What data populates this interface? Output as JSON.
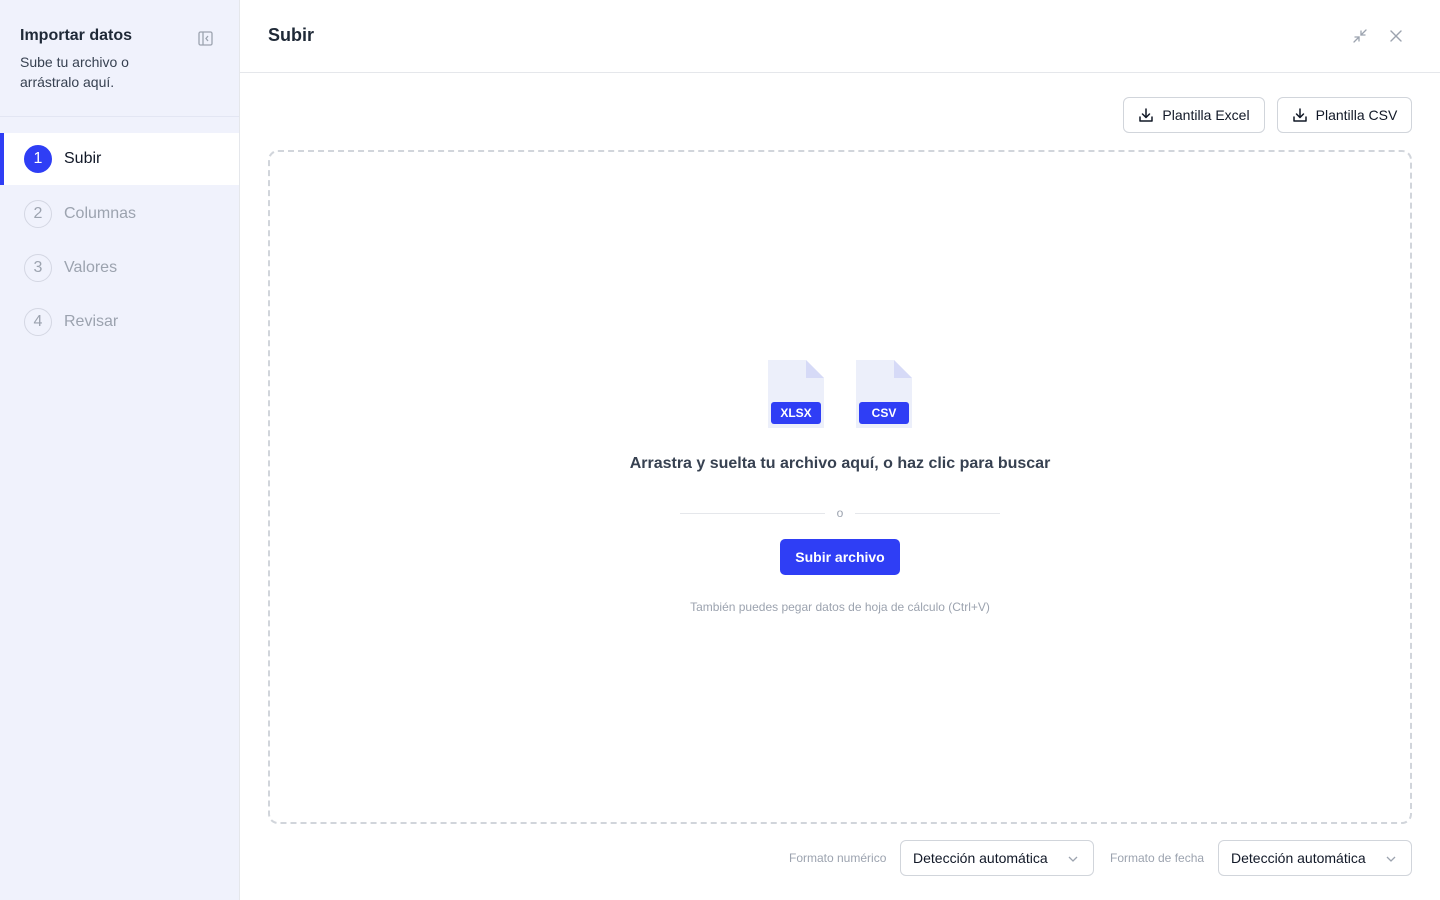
{
  "sidebar": {
    "title": "Importar datos",
    "subtitle": "Sube tu archivo o arrástralo aquí.",
    "steps": [
      {
        "number": "1",
        "label": "Subir",
        "active": true
      },
      {
        "number": "2",
        "label": "Columnas",
        "active": false
      },
      {
        "number": "3",
        "label": "Valores",
        "active": false
      },
      {
        "number": "4",
        "label": "Revisar",
        "active": false
      }
    ]
  },
  "header": {
    "title": "Subir",
    "icons": [
      "minimize-icon",
      "close-icon"
    ]
  },
  "templates": {
    "excel_label": "Plantilla Excel",
    "csv_label": "Plantilla CSV"
  },
  "dropzone": {
    "file_types": [
      "XLSX",
      "CSV"
    ],
    "title": "Arrastra y suelta tu archivo aquí, o haz clic para buscar",
    "or_text": "o",
    "upload_label": "Subir archivo",
    "hint": "También puedes pegar datos de hoja de cálculo (Ctrl+V)"
  },
  "formats": {
    "number_label": "Formato numérico",
    "number_value": "Detección automática",
    "date_label": "Formato de fecha",
    "date_value": "Detección automática"
  },
  "colors": {
    "accent": "#2f3ef5",
    "sidebar_bg": "#f0f2fc",
    "file_icon_bg": "#eceffa",
    "file_icon_fold": "#d6daf7"
  }
}
